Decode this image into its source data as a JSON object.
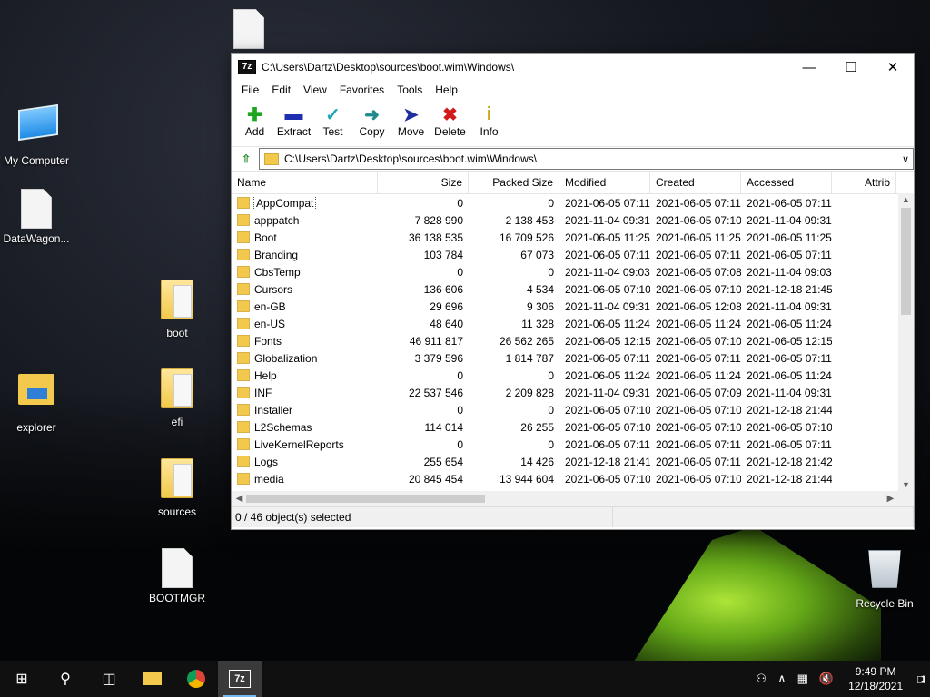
{
  "desktop": {
    "icons": [
      {
        "name": "my-computer",
        "label": "My Computer"
      },
      {
        "name": "datawagon",
        "label": "DataWagon..."
      },
      {
        "name": "explorer",
        "label": "explorer"
      },
      {
        "name": "boot",
        "label": "boot"
      },
      {
        "name": "efi",
        "label": "efi"
      },
      {
        "name": "sources",
        "label": "sources"
      },
      {
        "name": "bootmgr",
        "label": "BOOTMGR"
      },
      {
        "name": "recycle-bin",
        "label": "Recycle Bin"
      }
    ]
  },
  "window": {
    "title": "C:\\Users\\Dartz\\Desktop\\sources\\boot.wim\\Windows\\",
    "menu": [
      "File",
      "Edit",
      "View",
      "Favorites",
      "Tools",
      "Help"
    ],
    "toolbar": [
      {
        "label": "Add",
        "icon": "plus-icon",
        "color": "#1fa51f"
      },
      {
        "label": "Extract",
        "icon": "minus-icon",
        "color": "#1f2fb0"
      },
      {
        "label": "Test",
        "icon": "check-icon",
        "color": "#1fa7b8"
      },
      {
        "label": "Copy",
        "icon": "double-arrow-icon",
        "color": "#1f8a8a"
      },
      {
        "label": "Move",
        "icon": "arrow-right-icon",
        "color": "#1f2fa0"
      },
      {
        "label": "Delete",
        "icon": "x-icon",
        "color": "#d11a1a"
      },
      {
        "label": "Info",
        "icon": "info-icon",
        "color": "#c8a81a"
      }
    ],
    "address": "C:\\Users\\Dartz\\Desktop\\sources\\boot.wim\\Windows\\",
    "columns": [
      "Name",
      "Size",
      "Packed Size",
      "Modified",
      "Created",
      "Accessed",
      "Attrib"
    ],
    "rows": [
      [
        "AppCompat",
        "0",
        "0",
        "2021-06-05 07:11",
        "2021-06-05 07:11",
        "2021-06-05 07:11"
      ],
      [
        "apppatch",
        "7 828 990",
        "2 138 453",
        "2021-11-04 09:31",
        "2021-06-05 07:10",
        "2021-11-04 09:31"
      ],
      [
        "Boot",
        "36 138 535",
        "16 709 526",
        "2021-06-05 11:25",
        "2021-06-05 11:25",
        "2021-06-05 11:25"
      ],
      [
        "Branding",
        "103 784",
        "67 073",
        "2021-06-05 07:11",
        "2021-06-05 07:11",
        "2021-06-05 07:11"
      ],
      [
        "CbsTemp",
        "0",
        "0",
        "2021-11-04 09:03",
        "2021-06-05 07:08",
        "2021-11-04 09:03"
      ],
      [
        "Cursors",
        "136 606",
        "4 534",
        "2021-06-05 07:10",
        "2021-06-05 07:10",
        "2021-12-18 21:45"
      ],
      [
        "en-GB",
        "29 696",
        "9 306",
        "2021-11-04 09:31",
        "2021-06-05 12:08",
        "2021-11-04 09:31"
      ],
      [
        "en-US",
        "48 640",
        "11 328",
        "2021-06-05 11:24",
        "2021-06-05 11:24",
        "2021-06-05 11:24"
      ],
      [
        "Fonts",
        "46 911 817",
        "26 562 265",
        "2021-06-05 12:15",
        "2021-06-05 07:10",
        "2021-06-05 12:15"
      ],
      [
        "Globalization",
        "3 379 596",
        "1 814 787",
        "2021-06-05 07:11",
        "2021-06-05 07:11",
        "2021-06-05 07:11"
      ],
      [
        "Help",
        "0",
        "0",
        "2021-06-05 11:24",
        "2021-06-05 11:24",
        "2021-06-05 11:24"
      ],
      [
        "INF",
        "22 537 546",
        "2 209 828",
        "2021-11-04 09:31",
        "2021-06-05 07:09",
        "2021-11-04 09:31"
      ],
      [
        "Installer",
        "0",
        "0",
        "2021-06-05 07:10",
        "2021-06-05 07:10",
        "2021-12-18 21:44"
      ],
      [
        "L2Schemas",
        "114 014",
        "26 255",
        "2021-06-05 07:10",
        "2021-06-05 07:10",
        "2021-06-05 07:10"
      ],
      [
        "LiveKernelReports",
        "0",
        "0",
        "2021-06-05 07:11",
        "2021-06-05 07:11",
        "2021-06-05 07:11"
      ],
      [
        "Logs",
        "255 654",
        "14 426",
        "2021-12-18 21:41",
        "2021-06-05 07:11",
        "2021-12-18 21:42"
      ],
      [
        "media",
        "20 845 454",
        "13 944 604",
        "2021-06-05 07:10",
        "2021-06-05 07:10",
        "2021-12-18 21:44"
      ]
    ],
    "status": "0 / 46 object(s) selected"
  },
  "taskbar": {
    "apps": [
      "windows-start",
      "search",
      "task-view",
      "file-explorer",
      "chrome",
      "7zip"
    ],
    "time": "9:49 PM",
    "date": "12/18/2021",
    "notification_count": "1"
  }
}
